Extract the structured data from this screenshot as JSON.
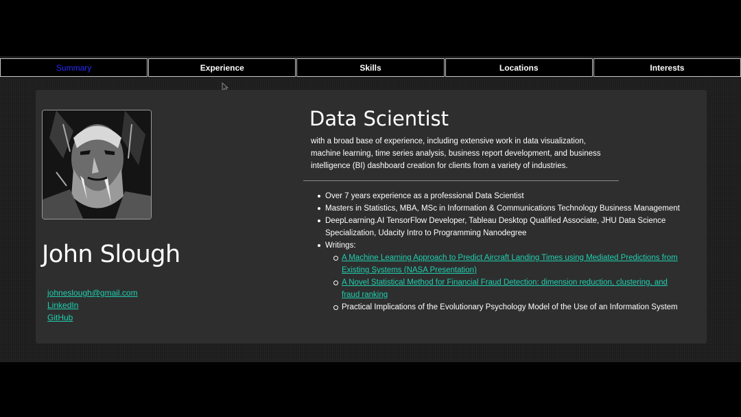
{
  "nav": {
    "tabs": [
      {
        "label": "Summary",
        "active": true
      },
      {
        "label": "Experience",
        "active": false
      },
      {
        "label": "Skills",
        "active": false
      },
      {
        "label": "Locations",
        "active": false
      },
      {
        "label": "Interests",
        "active": false
      }
    ]
  },
  "profile": {
    "name": "John Slough",
    "contacts": {
      "email": "johneslough@gmail.com",
      "linkedin": "LinkedIn",
      "github": "GitHub"
    }
  },
  "summary": {
    "title": "Data Scientist",
    "intro": "with a broad base of experience, including extensive work in data visualization, machine learning, time series analysis, business report development, and business intelligence (BI) dashboard creation for clients from a variety of industries.",
    "bullets": [
      "Over 7 years experience as a professional Data Scientist",
      "Masters in Statistics, MBA, MSc in Information & Communications Technology Business Management",
      "DeepLearning.AI TensorFlow Developer, Tableau Desktop Qualified Associate, JHU Data Science Specialization, Udacity Intro to Programming Nanodegree"
    ],
    "writings_label": "Writings:",
    "writings": [
      "A Machine Learning Approach to Predict Aircraft Landing Times using Mediated Predictions from Existing Systems (NASA Presentation)",
      "A Novel Statistical Method for Financial Fraud Detection: dimension reduction, clustering, and fraud ranking",
      "Practical Implications of the Evolutionary Psychology Model of the Use of an Information System"
    ]
  },
  "colors": {
    "link": "#1fd0b0",
    "active_tab": "#2a2aff",
    "card": "#2e2e2e"
  }
}
